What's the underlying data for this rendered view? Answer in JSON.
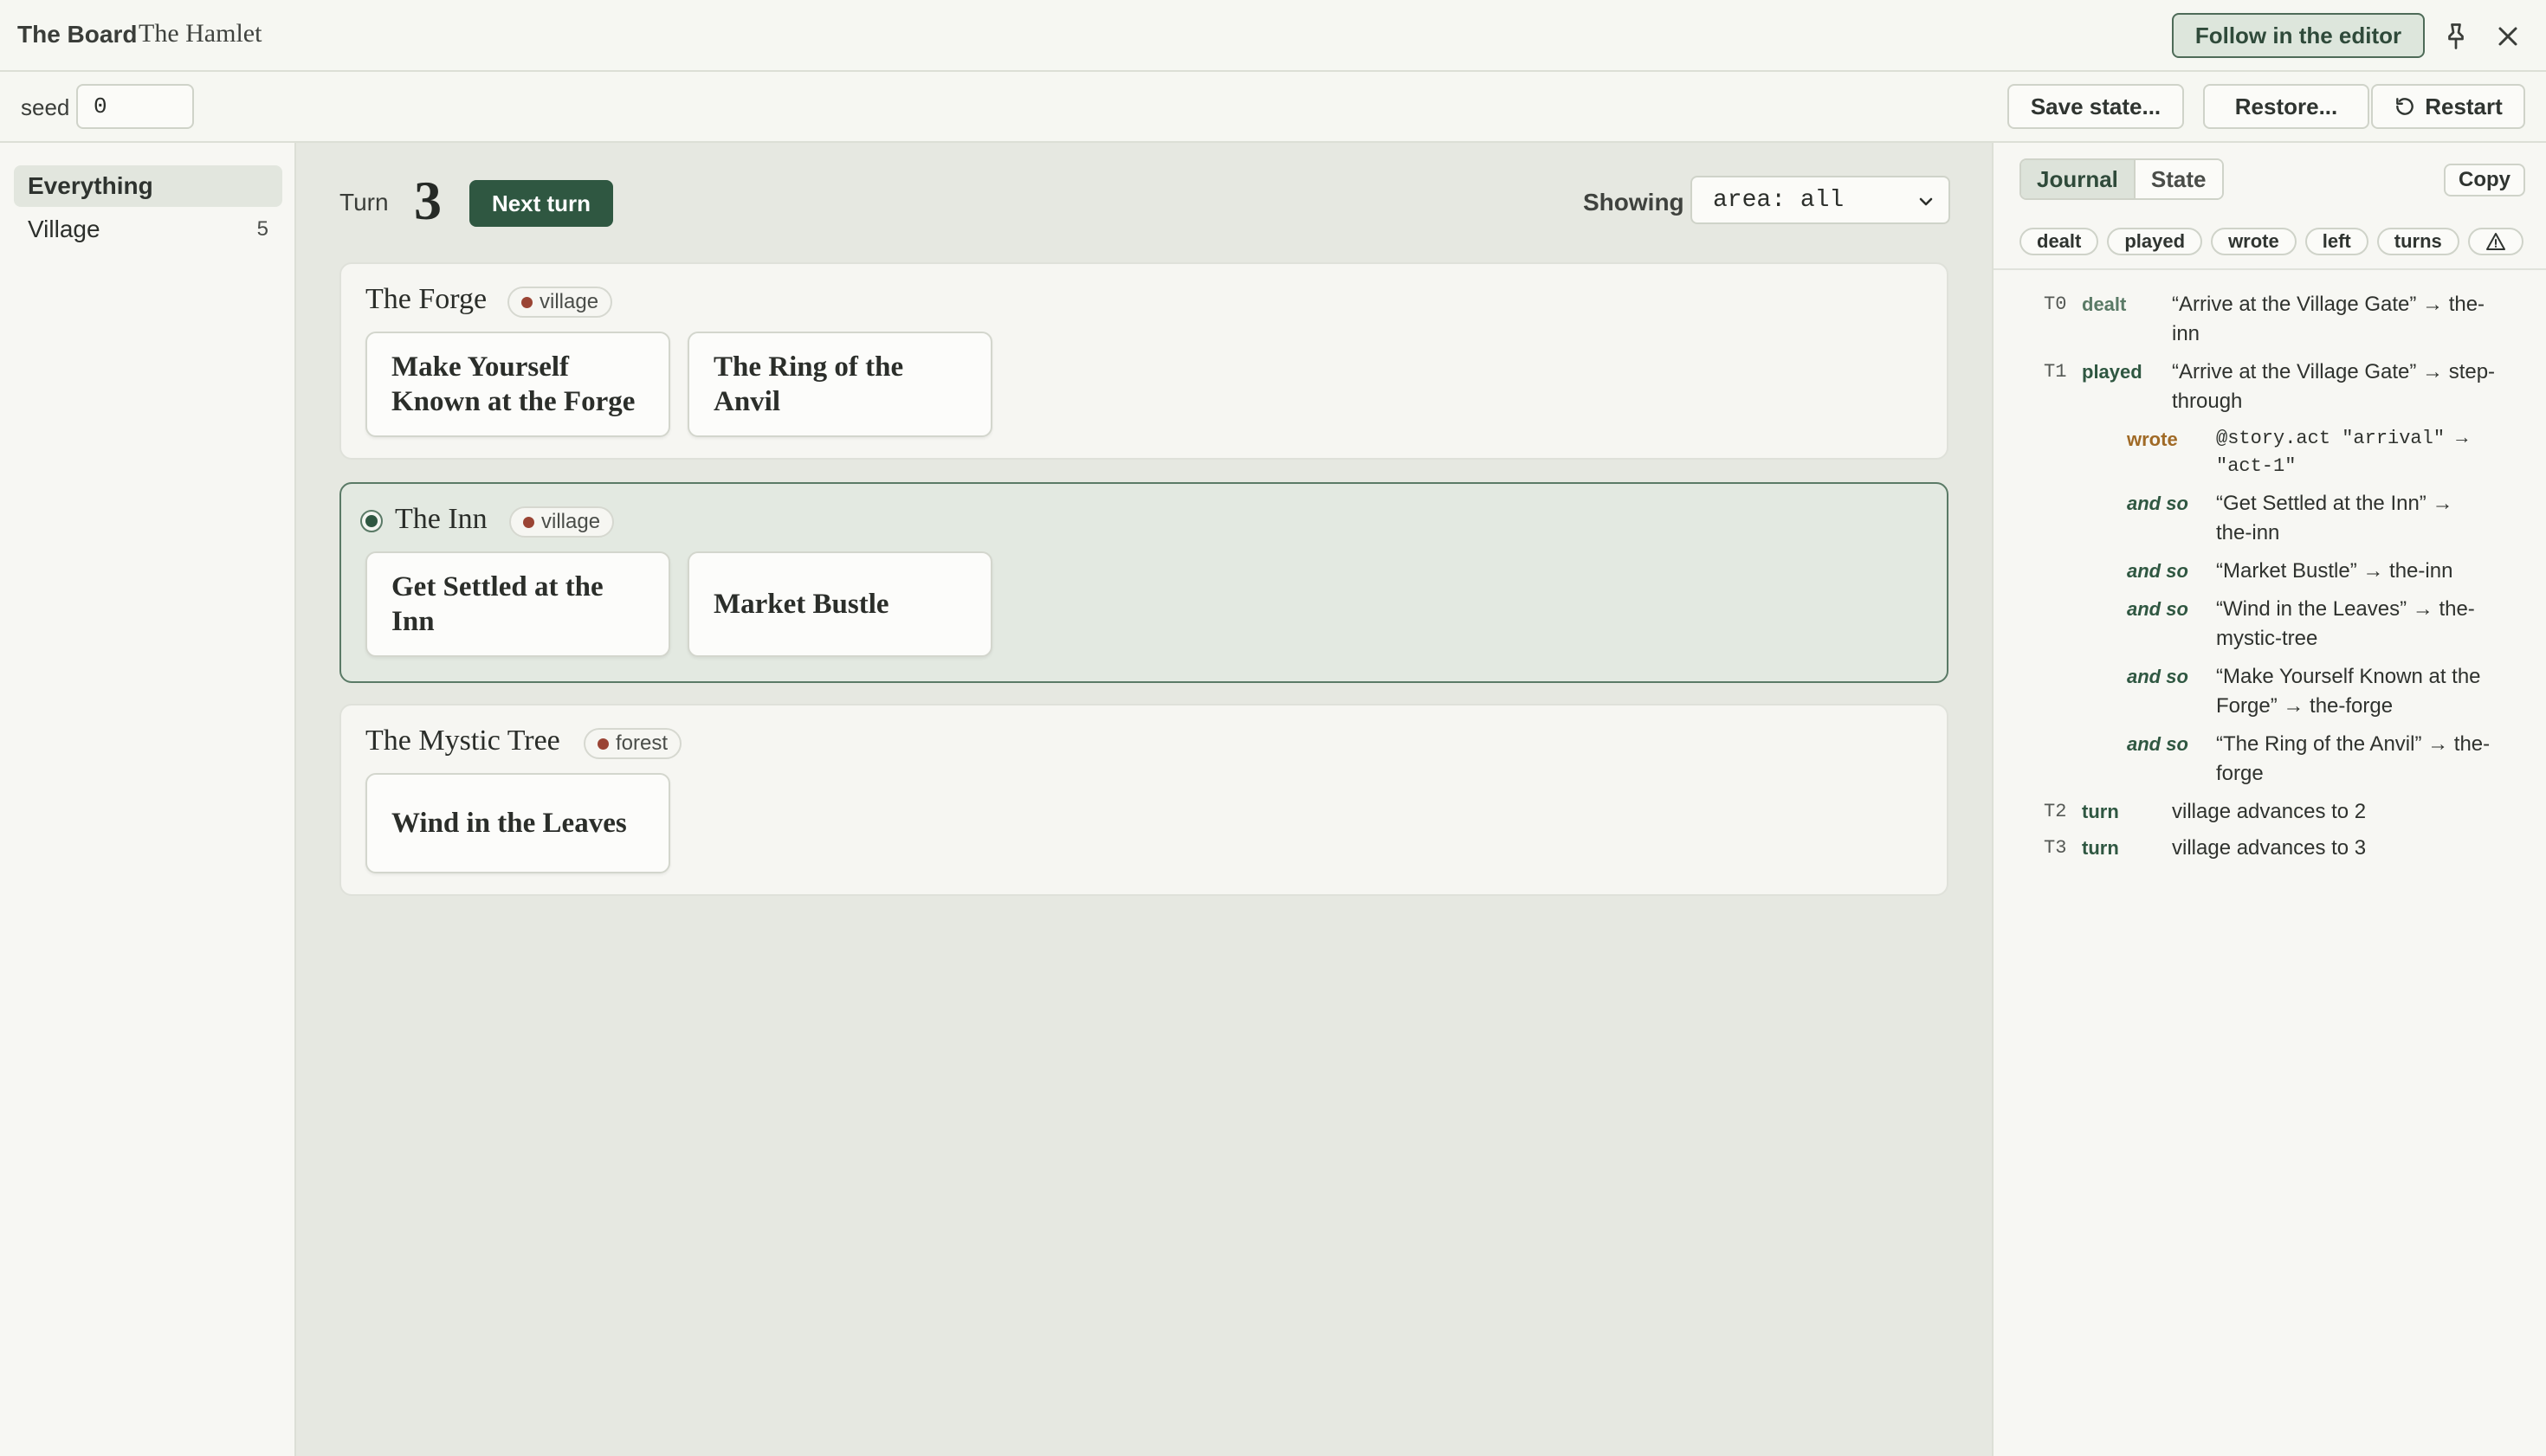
{
  "titlebar": {
    "app_title": "The Board",
    "subtitle": "The Hamlet",
    "follow_label": "Follow in the editor"
  },
  "toolbar": {
    "seed_label": "seed",
    "seed_value": "0",
    "save_label": "Save state...",
    "restore_label": "Restore...",
    "restart_label": "Restart"
  },
  "sidebar": {
    "items": [
      {
        "label": "Everything",
        "count": ""
      },
      {
        "label": "Village",
        "count": "5"
      }
    ]
  },
  "board": {
    "turn_label": "Turn",
    "turn_number": "3",
    "next_turn_label": "Next turn",
    "showing_label": "Showing",
    "area_filter": "area: all",
    "locations": [
      {
        "name": "The Forge",
        "tag": "village",
        "cards": [
          "Make Yourself Known at the Forge",
          "The Ring of the Anvil"
        ]
      },
      {
        "name": "The Inn",
        "tag": "village",
        "cards": [
          "Get Settled at the Inn",
          "Market Bustle"
        ]
      },
      {
        "name": "The Mystic Tree",
        "tag": "forest",
        "cards": [
          "Wind in the Leaves"
        ]
      }
    ]
  },
  "journal": {
    "tabs": [
      "Journal",
      "State"
    ],
    "copy_label": "Copy",
    "filters": [
      "dealt",
      "played",
      "wrote",
      "left",
      "turns"
    ],
    "entries": [
      {
        "t": "T0",
        "kind": "dealt",
        "lines": [
          "“Arrive at the Village Gate” → the-",
          "inn"
        ]
      },
      {
        "t": "T1",
        "kind": "played",
        "lines": [
          "“Arrive at the Village Gate” → step-",
          "through"
        ]
      },
      {
        "t": "",
        "kind": "wrote",
        "lines": [
          "@story.act \"arrival\" →",
          "\"act-1\""
        ]
      },
      {
        "t": "",
        "kind": "and so",
        "lines": [
          "“Get Settled at the Inn” →",
          "the-inn"
        ]
      },
      {
        "t": "",
        "kind": "and so",
        "lines": [
          "“Market Bustle” → the-inn"
        ]
      },
      {
        "t": "",
        "kind": "and so",
        "lines": [
          "“Wind in the Leaves” → the-",
          "mystic-tree"
        ]
      },
      {
        "t": "",
        "kind": "and so",
        "lines": [
          "“Make Yourself Known at the",
          "Forge” → the-forge"
        ]
      },
      {
        "t": "",
        "kind": "and so",
        "lines": [
          "“The Ring of the Anvil” → the-",
          "forge"
        ]
      },
      {
        "t": "T2",
        "kind": "turn",
        "lines": [
          "village advances to 2"
        ]
      },
      {
        "t": "T3",
        "kind": "turn",
        "lines": [
          "village advances to 3"
        ]
      }
    ]
  },
  "colors": {
    "accent": "#2f5741",
    "village_dot": "#9a4434",
    "wrote": "#a06a26"
  },
  "icons": [
    "pin-icon",
    "close-icon",
    "restart-icon",
    "chevron-down-icon",
    "warning-icon"
  ]
}
